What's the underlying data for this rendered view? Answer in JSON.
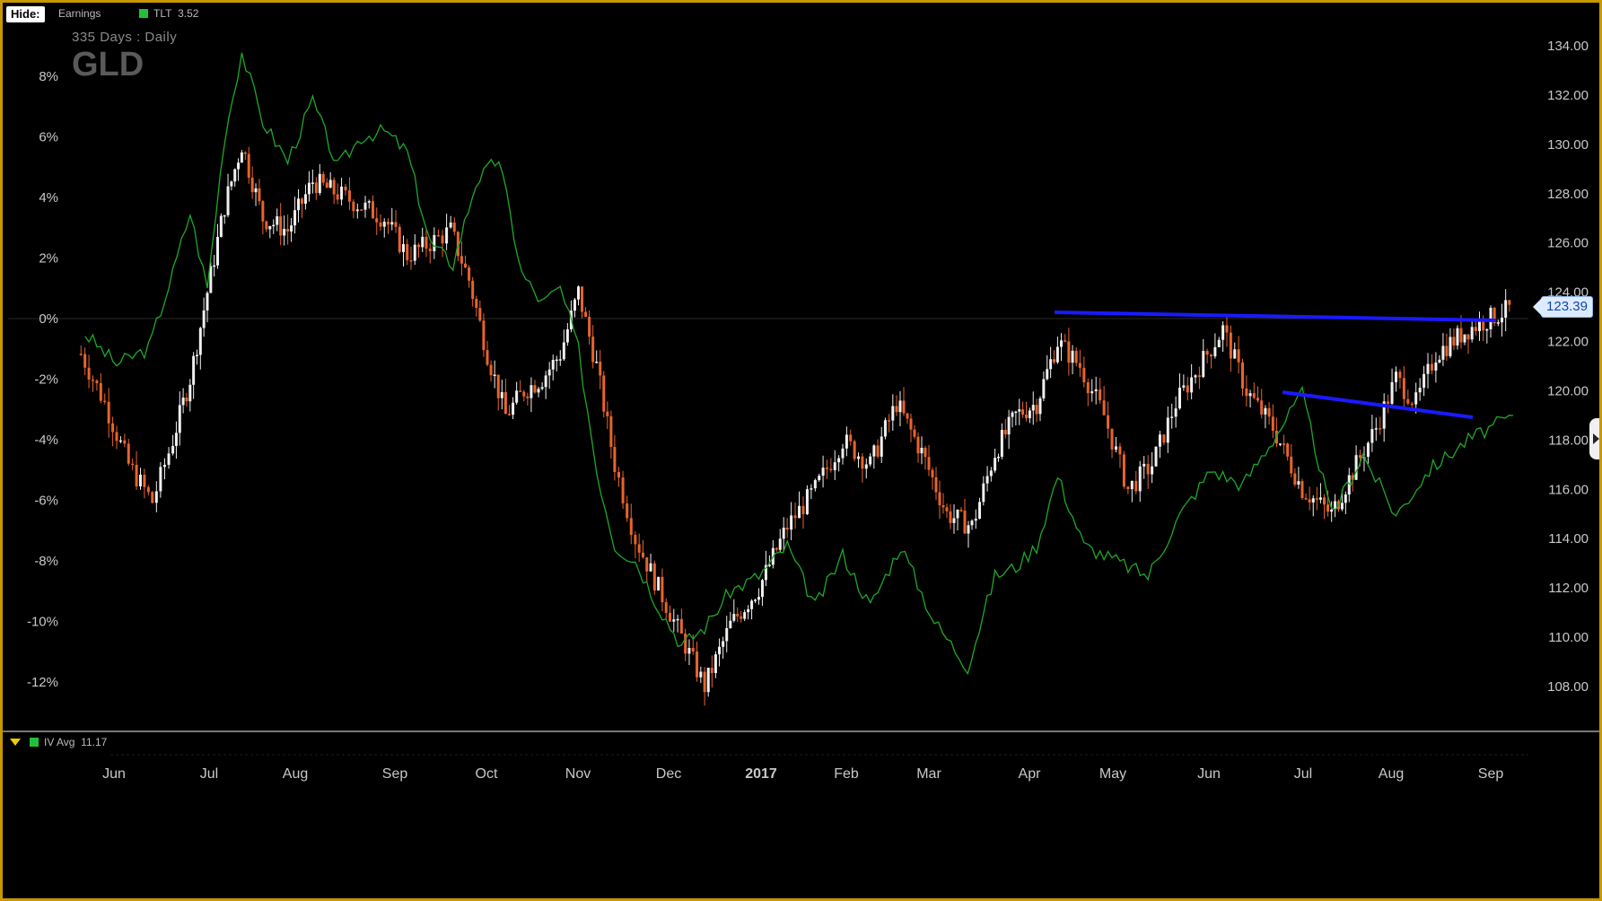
{
  "header": {
    "hide_label": "Hide:",
    "earnings_label": "Earnings",
    "comparison_label": "TLT",
    "comparison_value": "3.52",
    "subtitle": "335  Days : Daily",
    "symbol": "GLD"
  },
  "iv": {
    "label": "IV Avg",
    "value": "11.17"
  },
  "last_price_tag": "123.39",
  "colors": {
    "border": "#c99700",
    "up_candle": "#f0f0f0",
    "down_candle": "#e8642c",
    "comparison_line": "#1fa82a",
    "trendline": "#1a1aff"
  },
  "chart_data": {
    "type": "candlestick",
    "symbol": "GLD",
    "period": "335 Days : Daily",
    "x_labels": [
      "Jun",
      "Jul",
      "Aug",
      "Sep",
      "Oct",
      "Nov",
      "Dec",
      "2017",
      "Feb",
      "Mar",
      "Apr",
      "May",
      "Jun",
      "Jul",
      "Aug",
      "Sep"
    ],
    "right_axis": {
      "ticks": [
        "134.00",
        "132.00",
        "130.00",
        "128.00",
        "126.00",
        "124.00",
        "122.00",
        "120.00",
        "118.00",
        "116.00",
        "114.00",
        "112.00",
        "110.00",
        "108.00"
      ],
      "ylim": [
        107,
        135
      ]
    },
    "left_axis": {
      "ticks": [
        "8%",
        "6%",
        "4%",
        "2%",
        "0%",
        "-2%",
        "-4%",
        "-6%",
        "-8%",
        "-10%",
        "-12%"
      ],
      "ylim": [
        -13,
        9
      ]
    },
    "series": [
      {
        "name": "GLD",
        "close_points": [
          [
            "Jun",
            121.5
          ],
          [
            "Jun",
            119.5
          ],
          [
            "Jun",
            117.0
          ],
          [
            "Jun",
            115.5
          ],
          [
            "Jul",
            118.0
          ],
          [
            "Jul",
            120.5
          ],
          [
            "Jul",
            124.0
          ],
          [
            "Jul",
            127.5
          ],
          [
            "Jul",
            130.0
          ],
          [
            "Aug",
            127.0
          ],
          [
            "Aug",
            126.5
          ],
          [
            "Aug",
            128.5
          ],
          [
            "Aug",
            128.0
          ],
          [
            "Sep",
            127.5
          ],
          [
            "Sep",
            127.0
          ],
          [
            "Sep",
            125.5
          ],
          [
            "Sep",
            126.0
          ],
          [
            "Oct",
            126.5
          ],
          [
            "Oct",
            124.5
          ],
          [
            "Oct",
            121.5
          ],
          [
            "Oct",
            119.0
          ],
          [
            "Oct",
            120.0
          ],
          [
            "Nov",
            120.5
          ],
          [
            "Nov",
            121.5
          ],
          [
            "Nov",
            124.0
          ],
          [
            "Nov",
            121.0
          ],
          [
            "Nov",
            117.0
          ],
          [
            "Dec",
            114.0
          ],
          [
            "Dec",
            112.0
          ],
          [
            "Dec",
            110.0
          ],
          [
            "Dec",
            108.0
          ],
          [
            "2017",
            110.5
          ],
          [
            "2017",
            112.0
          ],
          [
            "2017",
            114.5
          ],
          [
            "Feb",
            116.0
          ],
          [
            "Feb",
            118.0
          ],
          [
            "Feb",
            117.0
          ],
          [
            "Mar",
            119.5
          ],
          [
            "Mar",
            117.5
          ],
          [
            "Mar",
            115.0
          ],
          [
            "Mar",
            114.5
          ],
          [
            "Apr",
            117.5
          ],
          [
            "Apr",
            119.0
          ],
          [
            "Apr",
            119.5
          ],
          [
            "Apr",
            122.0
          ],
          [
            "May",
            121.0
          ],
          [
            "May",
            119.0
          ],
          [
            "May",
            116.0
          ],
          [
            "May",
            117.0
          ],
          [
            "Jun",
            119.5
          ],
          [
            "Jun",
            121.0
          ],
          [
            "Jun",
            122.5
          ],
          [
            "Jun",
            120.0
          ],
          [
            "Jul",
            118.5
          ],
          [
            "Jul",
            116.0
          ],
          [
            "Jul",
            115.0
          ],
          [
            "Aug",
            117.0
          ],
          [
            "Aug",
            118.5
          ],
          [
            "Aug",
            120.5
          ],
          [
            "Aug",
            119.5
          ],
          [
            "Aug",
            121.5
          ],
          [
            "Sep",
            122.5
          ],
          [
            "Sep",
            123.39
          ]
        ]
      },
      {
        "name": "TLT",
        "value_label": "3.52",
        "pct_points": [
          [
            "Jun",
            -0.5
          ],
          [
            "Jun",
            -1.5
          ],
          [
            "Jun",
            -1.0
          ],
          [
            "Jul",
            1.5
          ],
          [
            "Jul",
            3.5
          ],
          [
            "Jul",
            1.0
          ],
          [
            "Jul",
            6.0
          ],
          [
            "Jul",
            8.8
          ],
          [
            "Aug",
            6.5
          ],
          [
            "Aug",
            5.2
          ],
          [
            "Aug",
            7.2
          ],
          [
            "Aug",
            5.0
          ],
          [
            "Sep",
            6.0
          ],
          [
            "Sep",
            6.2
          ],
          [
            "Sep",
            5.5
          ],
          [
            "Sep",
            2.5
          ],
          [
            "Oct",
            1.8
          ],
          [
            "Oct",
            4.5
          ],
          [
            "Oct",
            5.3
          ],
          [
            "Oct",
            1.5
          ],
          [
            "Nov",
            0.5
          ],
          [
            "Nov",
            1.0
          ],
          [
            "Nov",
            -1.0
          ],
          [
            "Nov",
            -5.0
          ],
          [
            "Nov",
            -7.5
          ],
          [
            "Dec",
            -8.0
          ],
          [
            "Dec",
            -9.5
          ],
          [
            "Dec",
            -10.8
          ],
          [
            "Dec",
            -10.2
          ],
          [
            "2017",
            -9.0
          ],
          [
            "2017",
            -8.5
          ],
          [
            "2017",
            -7.5
          ],
          [
            "Feb",
            -9.5
          ],
          [
            "Feb",
            -7.8
          ],
          [
            "Feb",
            -9.5
          ],
          [
            "Mar",
            -7.5
          ],
          [
            "Mar",
            -10.0
          ],
          [
            "Mar",
            -11.5
          ],
          [
            "Apr",
            -8.5
          ],
          [
            "Apr",
            -8.2
          ],
          [
            "Apr",
            -7.5
          ],
          [
            "Apr",
            -5.2
          ],
          [
            "May",
            -7.5
          ],
          [
            "May",
            -8.0
          ],
          [
            "May",
            -8.5
          ],
          [
            "Jun",
            -6.5
          ],
          [
            "Jun",
            -5.0
          ],
          [
            "Jun",
            -5.5
          ],
          [
            "Jul",
            -4.0
          ],
          [
            "Jul",
            -2.5
          ],
          [
            "Jul",
            -6.5
          ],
          [
            "Aug",
            -4.5
          ],
          [
            "Aug",
            -6.5
          ],
          [
            "Aug",
            -5.0
          ],
          [
            "Sep",
            -4.0
          ],
          [
            "Sep",
            -3.2
          ]
        ]
      }
    ],
    "annotations": [
      {
        "type": "trendline",
        "from": [
          "Apr",
          122.3
        ],
        "to": [
          "Sep",
          121.9
        ]
      },
      {
        "type": "trendline",
        "from": [
          "Jul",
          120.0
        ],
        "to": [
          "Sep",
          118.9
        ]
      }
    ],
    "last_price": 123.39,
    "grid": false,
    "legend": "top-left"
  }
}
